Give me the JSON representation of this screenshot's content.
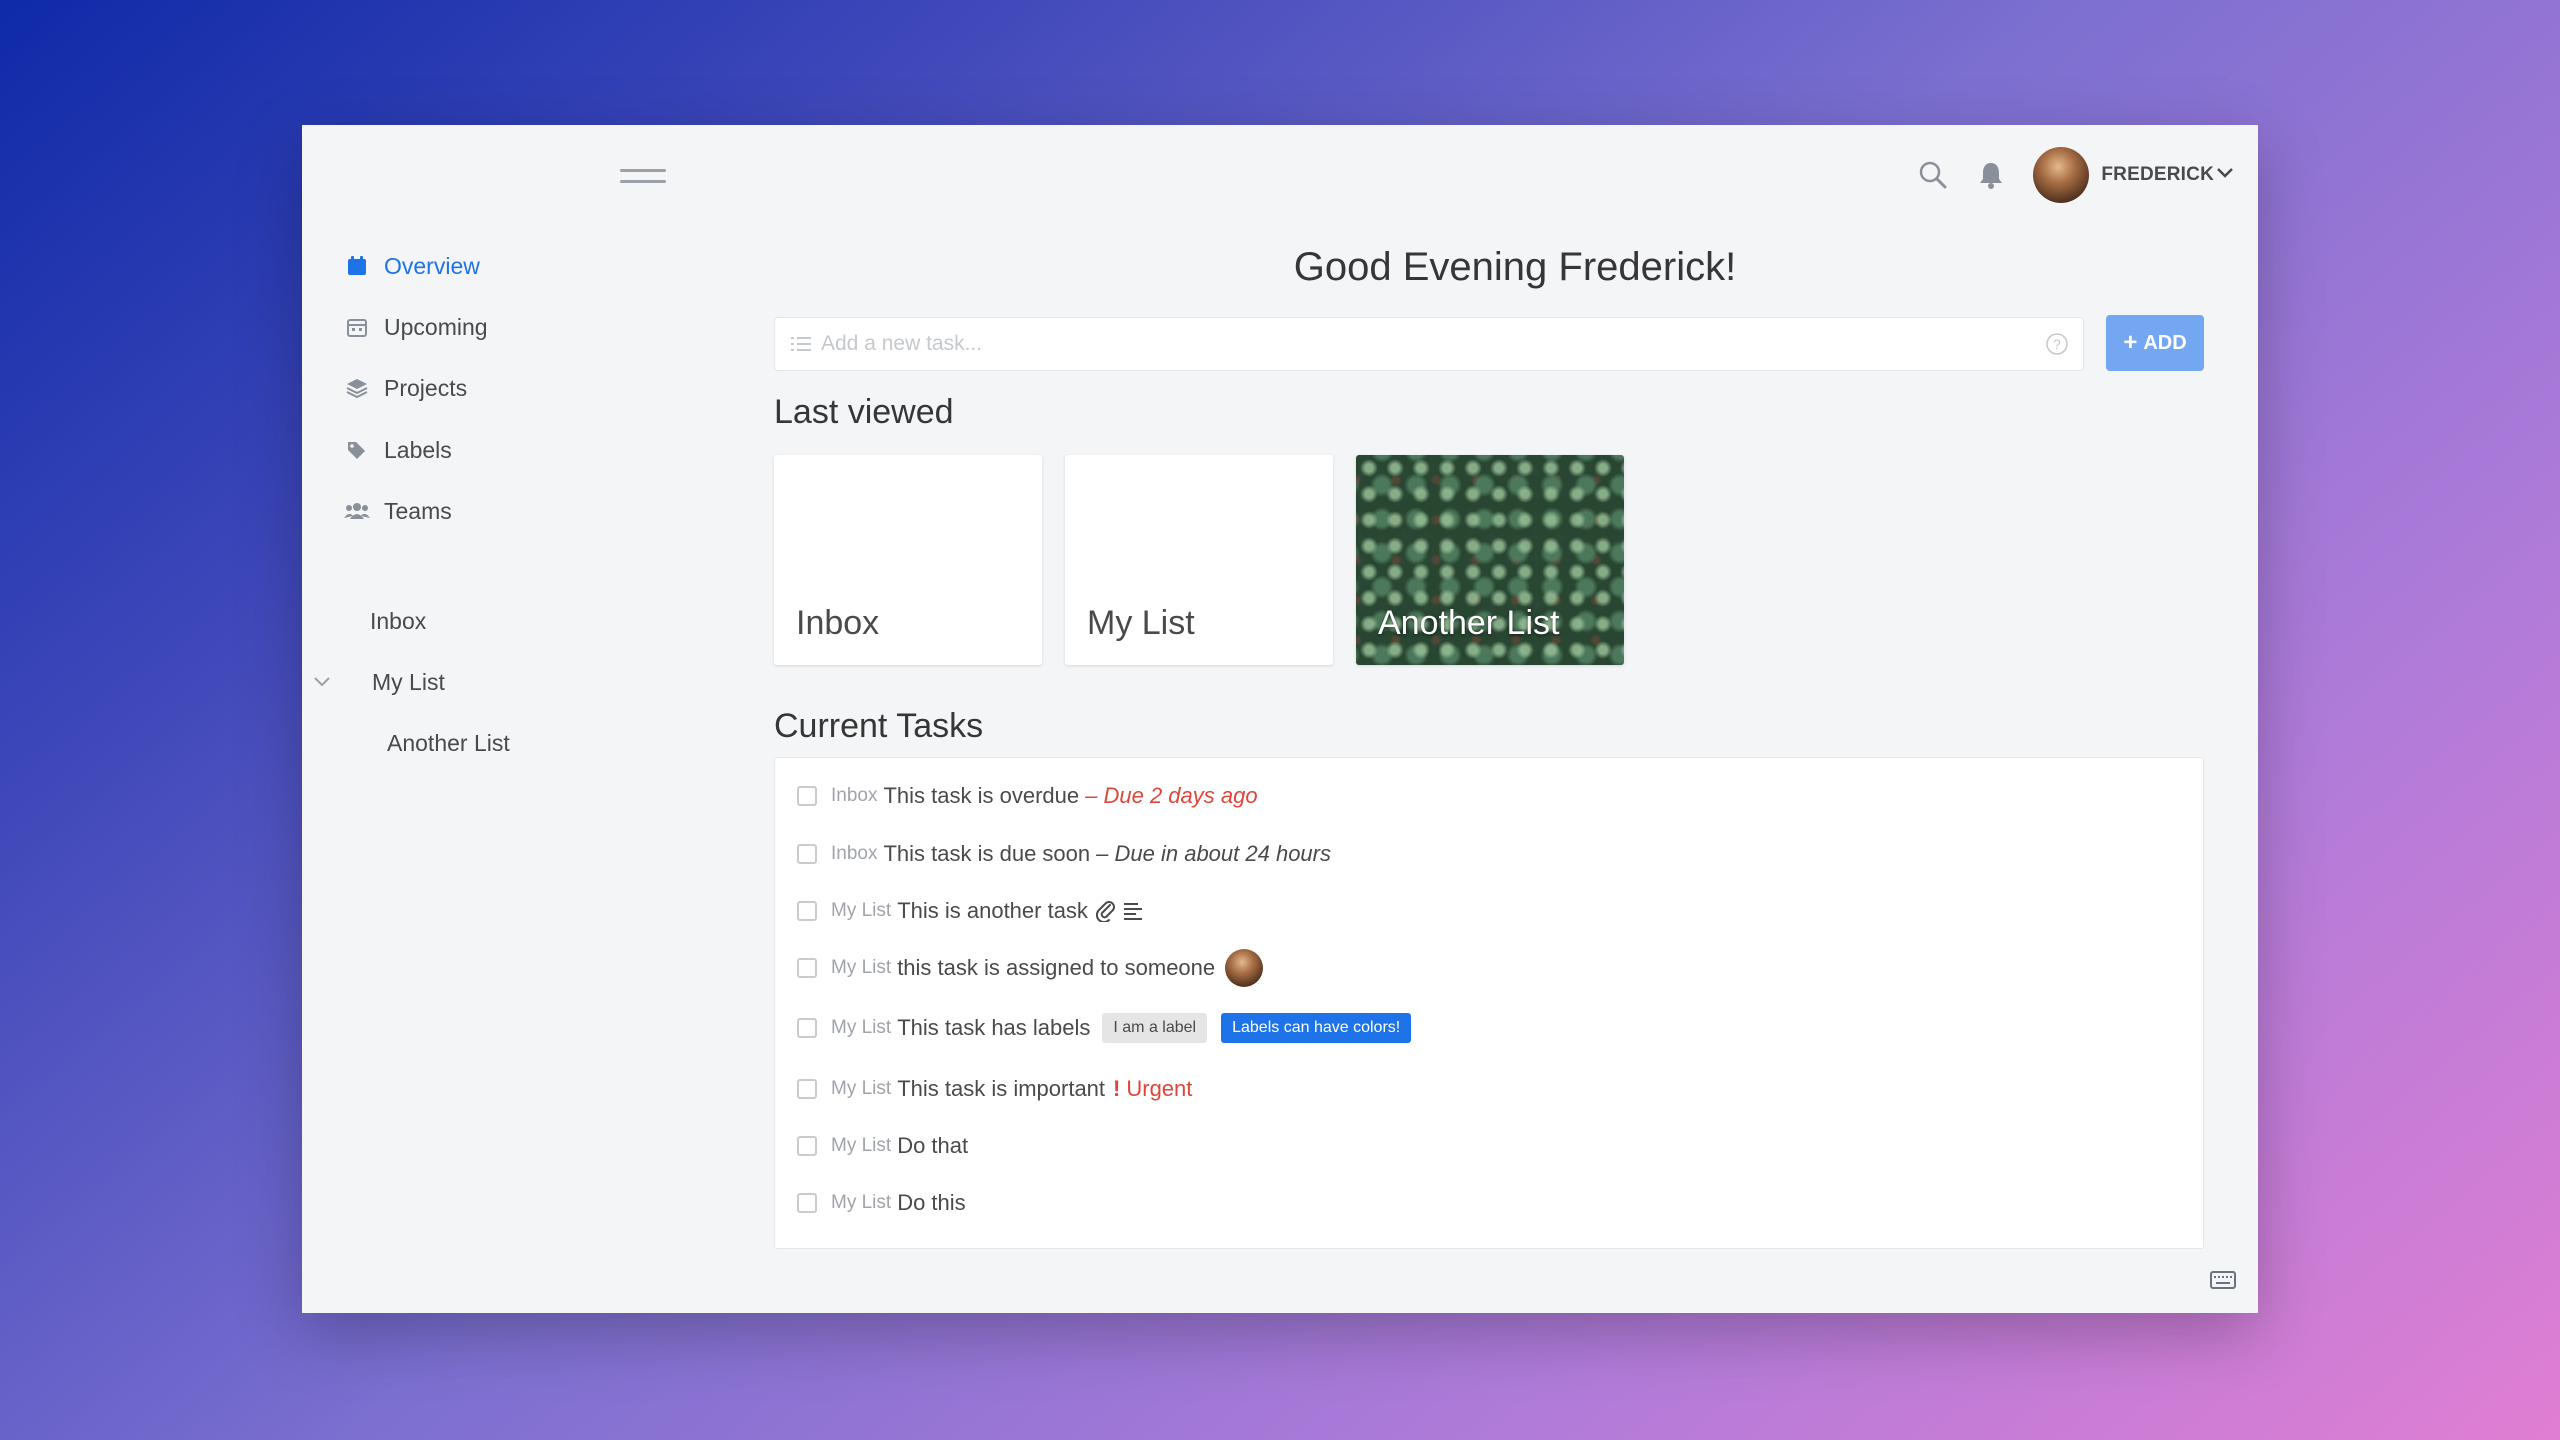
{
  "user": {
    "name": "FREDERICK"
  },
  "sidebar": {
    "nav": [
      {
        "label": "Overview",
        "icon": "calendar-icon",
        "active": true
      },
      {
        "label": "Upcoming",
        "icon": "calendar-grid-icon"
      },
      {
        "label": "Projects",
        "icon": "layers-icon"
      },
      {
        "label": "Labels",
        "icon": "tags-icon"
      },
      {
        "label": "Teams",
        "icon": "users-icon"
      }
    ],
    "lists": [
      {
        "label": "Inbox"
      },
      {
        "label": "My List"
      },
      {
        "label": "Another List"
      }
    ]
  },
  "main": {
    "greeting": "Good Evening Frederick!",
    "add_task": {
      "placeholder": "Add a new task...",
      "button": "ADD"
    },
    "last_viewed": {
      "title": "Last viewed",
      "cards": [
        {
          "title": "Inbox"
        },
        {
          "title": "My List"
        },
        {
          "title": "Another List"
        }
      ]
    },
    "current_tasks": {
      "title": "Current Tasks",
      "tasks": [
        {
          "list": "Inbox",
          "text": "This task is overdue",
          "due": "– Due 2 days ago"
        },
        {
          "list": "Inbox",
          "text": "This task is due soon",
          "due": "– Due in about 24 hours"
        },
        {
          "list": "My List",
          "text": "This is another task"
        },
        {
          "list": "My List",
          "text": "this task is assigned to someone"
        },
        {
          "list": "My List",
          "text": "This task has labels",
          "labels": [
            "I am a label",
            "Labels can have colors!"
          ]
        },
        {
          "list": "My List",
          "text": "This task is important",
          "priority": "Urgent"
        },
        {
          "list": "My List",
          "text": "Do that"
        },
        {
          "list": "My List",
          "text": "Do this"
        }
      ]
    }
  },
  "colors": {
    "accent": "#1e73e8",
    "add_button": "#73a7f2",
    "danger": "#e0453a"
  }
}
